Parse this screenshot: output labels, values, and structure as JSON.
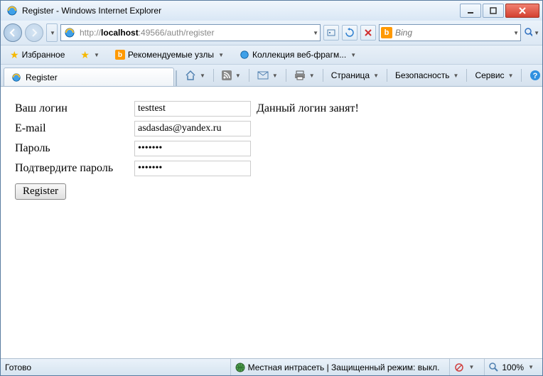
{
  "window": {
    "title": "Register - Windows Internet Explorer"
  },
  "nav": {
    "url_prefix": "http://",
    "url_host": "localhost",
    "url_port": ":49566",
    "url_path": "/auth/register",
    "search_placeholder": "Bing"
  },
  "favbar": {
    "favorites": "Избранное",
    "recommended": "Рекомендуемые узлы",
    "webfragments": "Коллекция веб-фрагм..."
  },
  "tab": {
    "title": "Register"
  },
  "cmdbar": {
    "page": "Страница",
    "safety": "Безопасность",
    "tools": "Сервис"
  },
  "form": {
    "login_label": "Ваш логин",
    "login_value": "testtest",
    "login_error": "Данный логин занят!",
    "email_label": "E-mail",
    "email_value": "asdasdas@yandex.ru",
    "password_label": "Пароль",
    "password_value": "•••••••",
    "confirm_label": "Подтвердите пароль",
    "confirm_value": "•••••••",
    "submit": "Register"
  },
  "status": {
    "ready": "Готово",
    "zone": "Местная интрасеть | Защищенный режим: выкл.",
    "zoom": "100%"
  }
}
